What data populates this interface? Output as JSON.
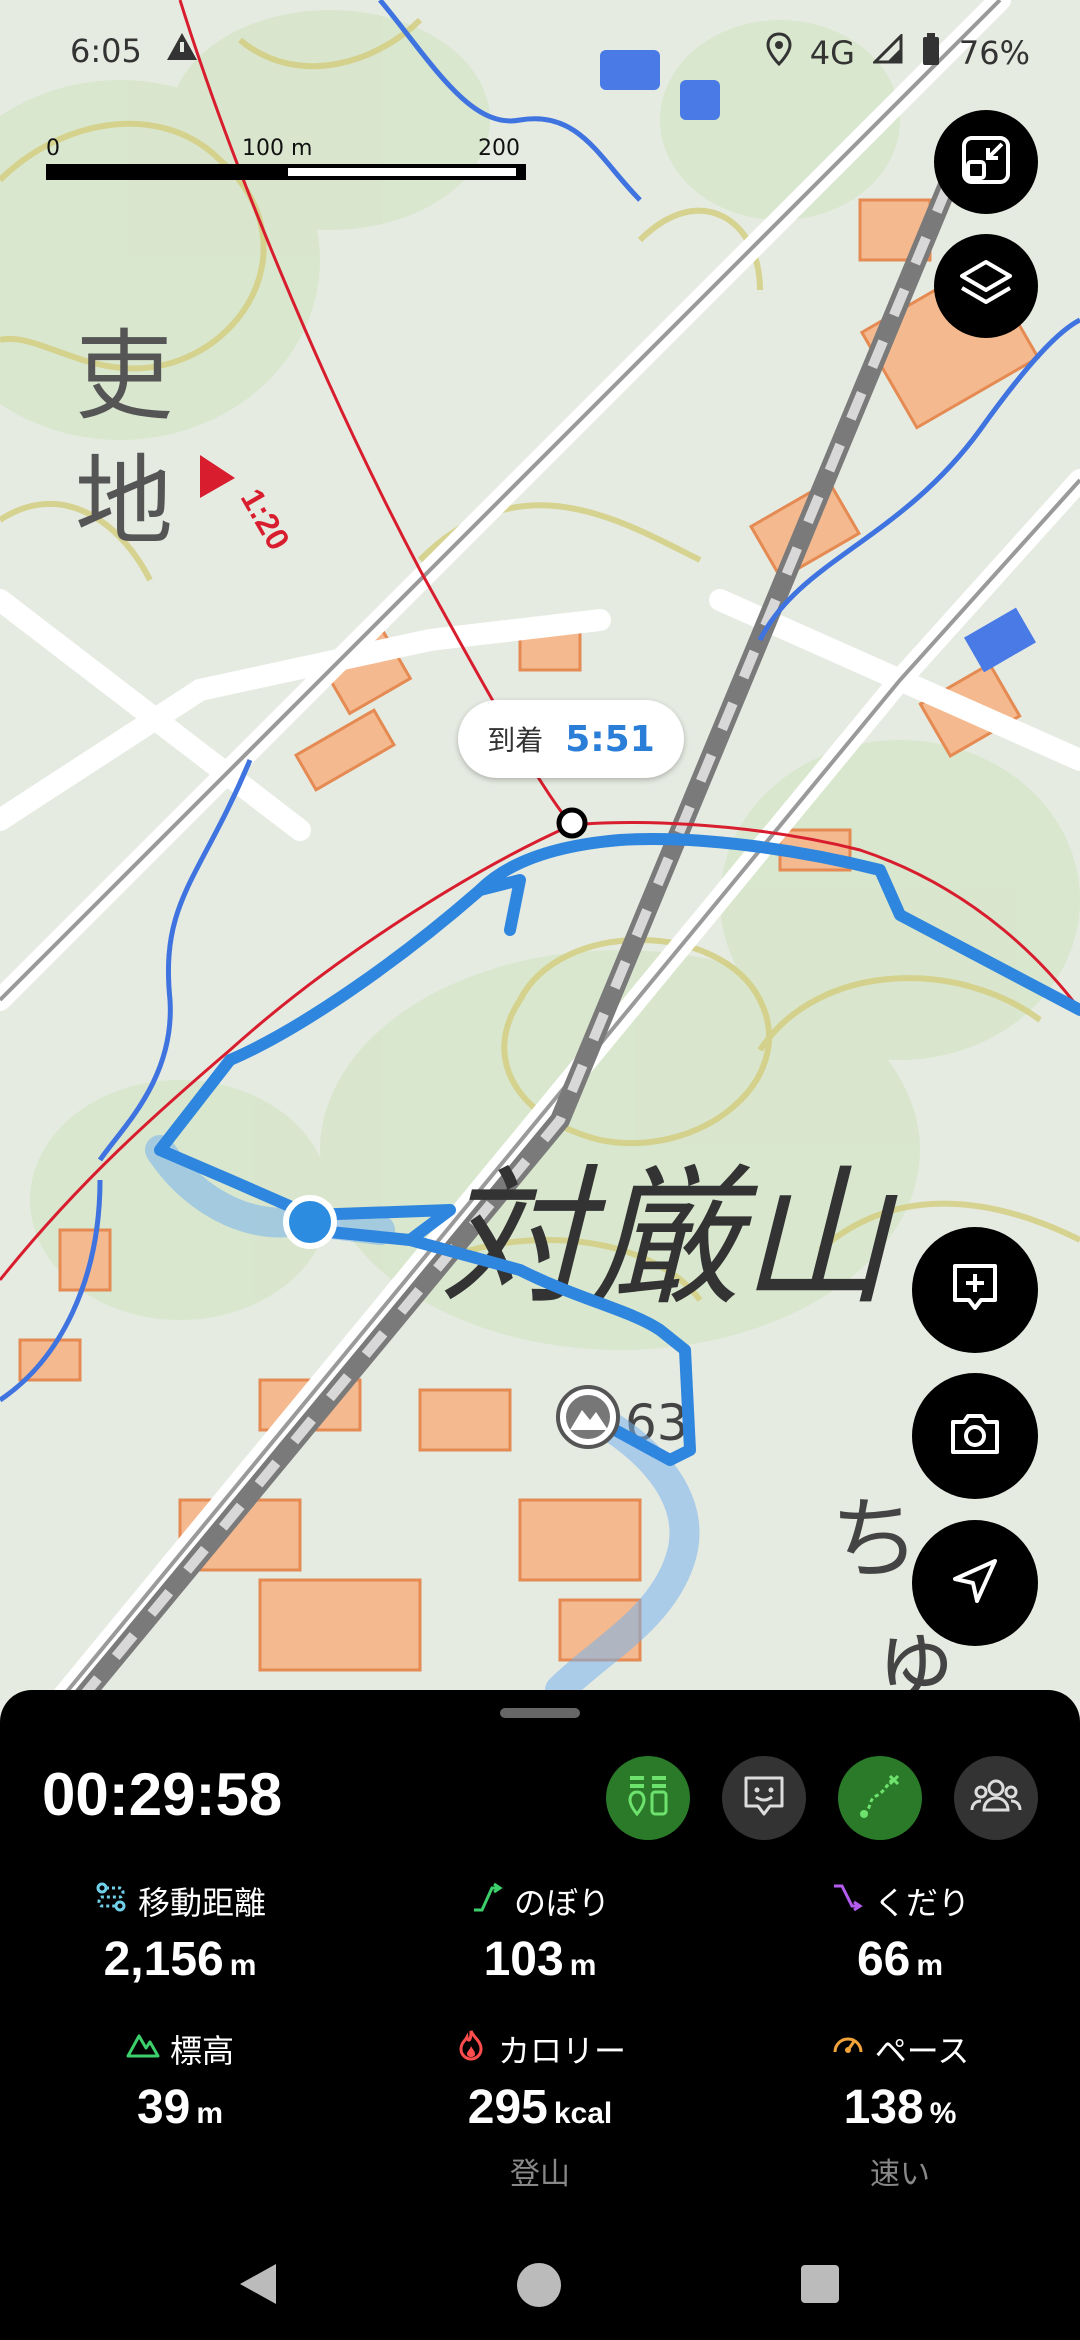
{
  "status_bar": {
    "time": "6:05",
    "network": "4G",
    "battery": "76%"
  },
  "scale": {
    "zero": "0",
    "mid": "100 m",
    "max": "200 m"
  },
  "map": {
    "kanji_top": "吏",
    "kanji_bottom": "地",
    "mountain_name": "対厳山",
    "elevation_fragment": "63",
    "fragment_chi": "ち",
    "fragment_yu": "ゅ",
    "marker_time": "1:20"
  },
  "arrival": {
    "label": "到着",
    "time": "5:51"
  },
  "buttons": {
    "fullscreen_icon": "fullscreen-exit",
    "layers_icon": "layers",
    "memo_icon": "add-note",
    "camera_icon": "camera",
    "locate_icon": "navigation-arrow"
  },
  "sheet": {
    "elapsed": "00:29:58",
    "stats": [
      {
        "label": "移動距離",
        "value": "2,156",
        "unit": "m",
        "icon": "route",
        "color": "#6fd0e8"
      },
      {
        "label": "のぼり",
        "value": "103",
        "unit": "m",
        "icon": "ascent",
        "color": "#3ccf6b"
      },
      {
        "label": "くだり",
        "value": "66",
        "unit": "m",
        "icon": "descent",
        "color": "#b45cf0"
      },
      {
        "label": "標高",
        "value": "39",
        "unit": "m",
        "icon": "mountain",
        "color": "#3ccf6b"
      },
      {
        "label": "カロリー",
        "value": "295",
        "unit": "kcal",
        "icon": "flame",
        "color": "#ff4d4d",
        "sub": "登山"
      },
      {
        "label": "ペース",
        "value": "138",
        "unit": "%",
        "icon": "speedometer",
        "color": "#f2a43a",
        "sub": "速い"
      }
    ]
  }
}
